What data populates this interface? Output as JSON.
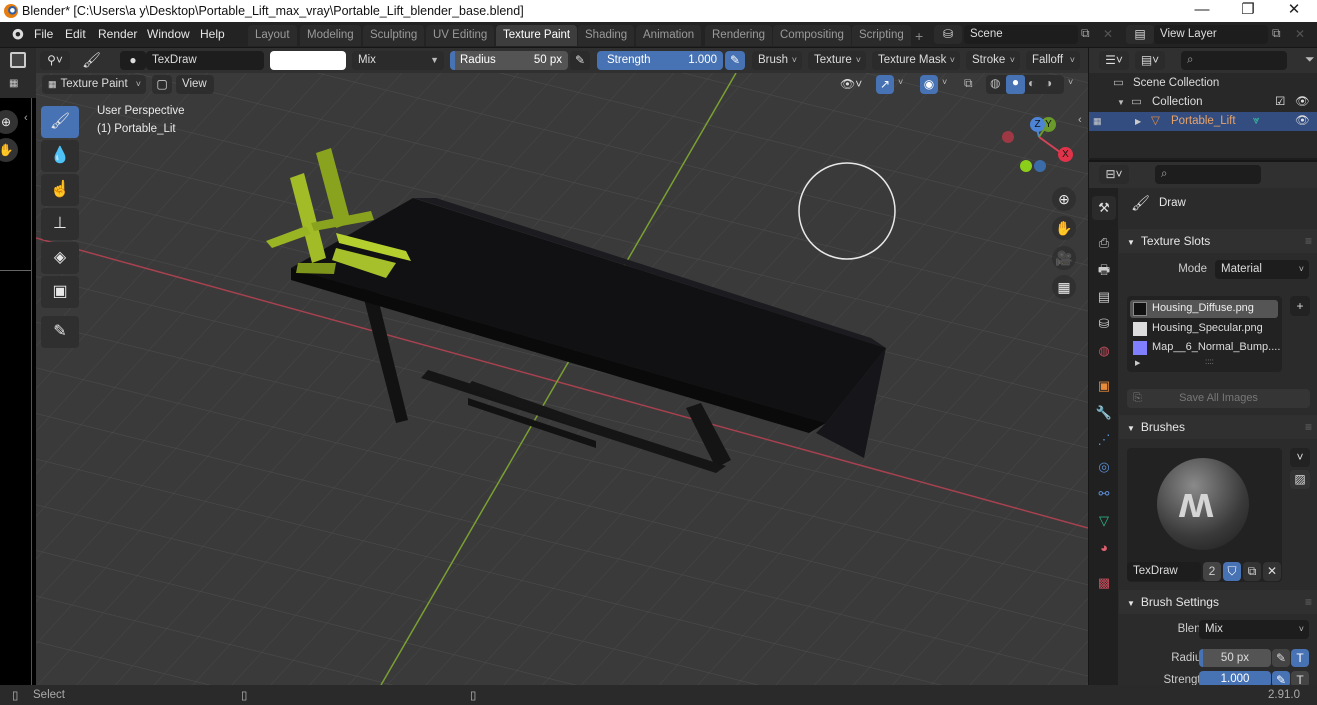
{
  "window": {
    "title": "Blender* [C:\\Users\\a y\\Desktop\\Portable_Lift_max_vray\\Portable_Lift_blender_base.blend]",
    "controls": {
      "minimize": "—",
      "maximize": "❐",
      "close": "✕"
    }
  },
  "menubar": {
    "items": [
      "File",
      "Edit",
      "Render",
      "Window",
      "Help"
    ]
  },
  "workspaces": {
    "tabs": [
      "Layout",
      "Modeling",
      "Sculpting",
      "UV Editing",
      "Texture Paint",
      "Shading",
      "Animation",
      "Rendering",
      "Compositing",
      "Scripting"
    ],
    "active": "Texture Paint",
    "add_label": "+"
  },
  "scene": {
    "name": "Scene",
    "view_layer": "View Layer"
  },
  "tool_header": {
    "brush_name": "TexDraw",
    "color_hex": "#ffffff",
    "blend": "Mix",
    "radius_label": "Radius",
    "radius_value": "50 px",
    "strength_label": "Strength",
    "strength_value": "1.000",
    "strength_fraction": 1.0,
    "menus": [
      "Brush",
      "Texture",
      "Texture Mask",
      "Stroke",
      "Falloff"
    ]
  },
  "view_header": {
    "mode": "Texture Paint",
    "view_label": "View"
  },
  "viewport": {
    "perspective_label": "User Perspective",
    "object_label": "(1) Portable_Lit",
    "gizmo": {
      "x": "X",
      "y": "Y",
      "z": "Z"
    }
  },
  "toolbar": {
    "tools": [
      {
        "name": "draw",
        "icon": "🖌",
        "active": true
      },
      {
        "name": "soften",
        "icon": "💧",
        "active": false
      },
      {
        "name": "smear",
        "icon": "☝",
        "active": false
      },
      {
        "name": "clone",
        "icon": "⊥",
        "active": false
      },
      {
        "name": "fill",
        "icon": "◈",
        "active": false
      },
      {
        "name": "mask",
        "icon": "▣",
        "active": false
      },
      {
        "name": "annotate",
        "icon": "✎",
        "active": false
      }
    ]
  },
  "outliner": {
    "search_placeholder": "",
    "rows": [
      {
        "label": "Scene Collection",
        "level": 0
      },
      {
        "label": "Collection",
        "level": 1,
        "checked": true,
        "visible": true
      },
      {
        "label": "Portable_Lift",
        "level": 2,
        "selected": true,
        "visible": true
      }
    ]
  },
  "properties": {
    "search_placeholder": "",
    "tool_name": "Draw",
    "texture_slots": {
      "title": "Texture Slots",
      "mode_label": "Mode",
      "mode_value": "Material",
      "slots": [
        {
          "name": "Housing_Diffuse.png",
          "thumb": "#111111",
          "selected": true
        },
        {
          "name": "Housing_Specular.png",
          "thumb": "#dddddd",
          "selected": false
        },
        {
          "name": "Map__6_Normal_Bump....",
          "thumb": "#8080ff",
          "selected": false
        }
      ],
      "save_all_label": "Save All Images"
    },
    "brushes": {
      "title": "Brushes",
      "brush_name": "TexDraw",
      "users": "2"
    },
    "brush_settings": {
      "title": "Brush Settings",
      "blend_label": "Blend",
      "blend_value": "Mix",
      "radius_label": "Radius",
      "radius_value": "50 px",
      "strength_label": "Strength",
      "strength_value": "1.000"
    }
  },
  "statusbar": {
    "left_action": "Select",
    "version": "2.91.0"
  }
}
